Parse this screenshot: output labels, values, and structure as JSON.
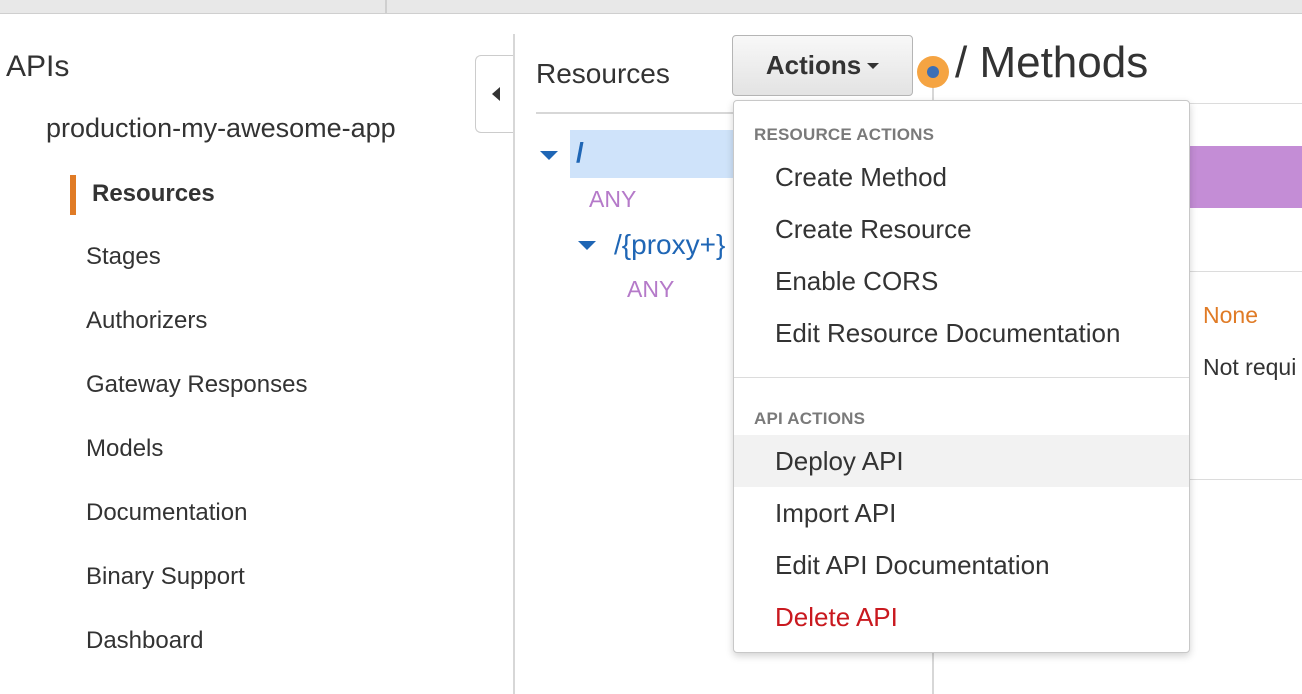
{
  "left_nav": {
    "title": "APIs",
    "api_name": "production-my-awesome-app",
    "items": [
      {
        "label": "Resources",
        "active": true
      },
      {
        "label": "Stages"
      },
      {
        "label": "Authorizers"
      },
      {
        "label": "Gateway Responses"
      },
      {
        "label": "Models"
      },
      {
        "label": "Documentation"
      },
      {
        "label": "Binary Support"
      },
      {
        "label": "Dashboard"
      }
    ]
  },
  "resources": {
    "heading": "Resources",
    "actions_label": "Actions",
    "tree": [
      {
        "path": "/",
        "method": "ANY"
      },
      {
        "path": "/{proxy+}",
        "method": "ANY"
      }
    ]
  },
  "methods": {
    "title": "/ Methods",
    "auth_value": "None",
    "api_key_value": "Not requi"
  },
  "dropdown": {
    "resource_section": "RESOURCE ACTIONS",
    "resource_items": [
      "Create Method",
      "Create Resource",
      "Enable CORS",
      "Edit Resource Documentation"
    ],
    "api_section": "API ACTIONS",
    "api_items": [
      "Deploy API",
      "Import API",
      "Edit API Documentation",
      "Delete API"
    ]
  },
  "colors": {
    "accent": "#e07b26",
    "link": "#1f66b5",
    "method": "#b57ac9",
    "danger": "#c9191f",
    "selection": "#cfe3fa"
  }
}
